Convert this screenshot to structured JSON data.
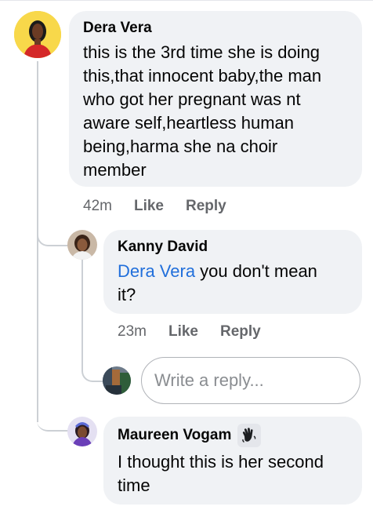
{
  "comments": [
    {
      "author": "Dera Vera",
      "text_lines": [
        "this is the 3rd time she is doing",
        "this,that innocent baby,the man",
        "who got her pregnant was nt",
        "aware self,heartless human",
        "being,harma she na choir",
        "member"
      ],
      "time": "42m",
      "like_label": "Like",
      "reply_label": "Reply"
    }
  ],
  "replies": [
    {
      "author": "Kanny David",
      "mention": "Dera Vera",
      "text_line1_rest": " you don't mean",
      "text_line2": "it?",
      "time": "23m",
      "like_label": "Like",
      "reply_label": "Reply"
    },
    {
      "author": "Maureen Vogam",
      "badge_icon": "waving-hand-icon",
      "text_lines": [
        "I thought this is her second",
        "time"
      ]
    }
  ],
  "reply_box": {
    "placeholder": "Write a reply..."
  },
  "colors": {
    "bubble": "#f0f2f5",
    "mention": "#216fdb",
    "meta": "#65676b",
    "thread_line": "#ccd0d5"
  }
}
